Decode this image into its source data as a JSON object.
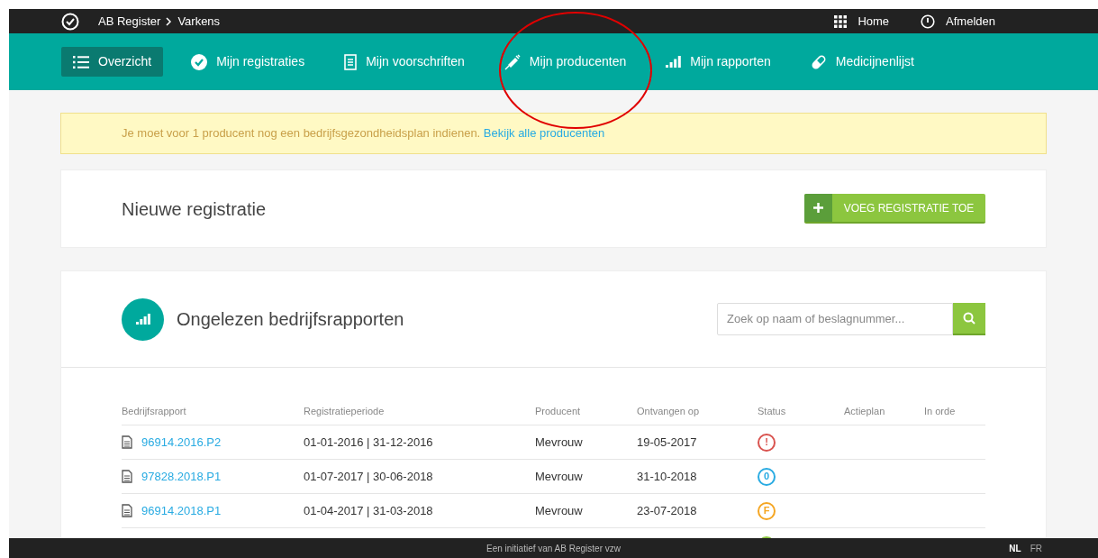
{
  "topbar": {
    "app": "AB Register",
    "section": "Varkens",
    "links": [
      {
        "label": "Home"
      },
      {
        "label": "Afmelden"
      }
    ]
  },
  "nav": [
    {
      "label": "Overzicht",
      "selected": true
    },
    {
      "label": "Mijn registraties",
      "selected": false
    },
    {
      "label": "Mijn voorschriften",
      "selected": false
    },
    {
      "label": "Mijn producenten",
      "selected": false
    },
    {
      "label": "Mijn rapporten",
      "selected": false
    },
    {
      "label": "Medicijnenlijst",
      "selected": false
    }
  ],
  "alert": {
    "text": "Je moet voor 1 producent nog een bedrijfsgezondheidsplan indienen.",
    "link": "Bekijk alle producenten"
  },
  "new_registration": {
    "title": "Nieuwe registratie",
    "button": "VOEG REGISTRATIE TOE"
  },
  "reports": {
    "title": "Ongelezen bedrijfsrapporten",
    "search": {
      "placeholder": "Zoek op naam of beslagnummer..."
    },
    "columns": [
      "Bedrijfsrapport",
      "Registratieperiode",
      "Producent",
      "Ontvangen op",
      "Status",
      "Actieplan",
      "In orde"
    ],
    "rows": [
      {
        "report": "96914.2016.P2",
        "period": "01-01-2016 | 31-12-2016",
        "producer": "Mevrouw",
        "received": "19-05-2017",
        "status": {
          "symbol": "!",
          "color": "#d9534f"
        }
      },
      {
        "report": "97828.2018.P1",
        "period": "01-07-2017 | 30-06-2018",
        "producer": "Mevrouw",
        "received": "31-10-2018",
        "status": {
          "symbol": "0",
          "color": "#29abe2"
        }
      },
      {
        "report": "96914.2018.P1",
        "period": "01-04-2017 | 31-03-2018",
        "producer": "Mevrouw",
        "received": "23-07-2018",
        "status": {
          "symbol": "F",
          "color": "#f5a623"
        }
      },
      {
        "status": {
          "color": "#8cc63f"
        }
      }
    ]
  },
  "footer": {
    "text": "Een initiatief van AB Register vzw",
    "languages": [
      {
        "label": "NL",
        "selected": true
      },
      {
        "label": "FR",
        "selected": false
      }
    ]
  }
}
